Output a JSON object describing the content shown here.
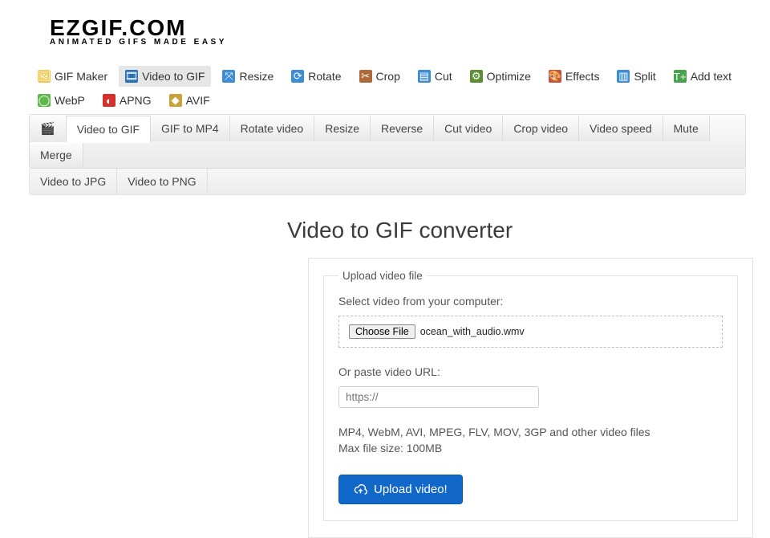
{
  "logo": {
    "main": "EZGIF.COM",
    "sub": "ANIMATED GIFS MADE EASY"
  },
  "main_nav": [
    {
      "label": "GIF Maker",
      "icon": "image-icon",
      "icon_glyph": "🖼",
      "icon_bg": "#f2c94c"
    },
    {
      "label": "Video to GIF",
      "icon": "film-icon",
      "icon_glyph": "🎞",
      "icon_bg": "#2d6fb3",
      "active": true
    },
    {
      "label": "Resize",
      "icon": "resize-icon",
      "icon_glyph": "⤧",
      "icon_bg": "#3c8dd6"
    },
    {
      "label": "Rotate",
      "icon": "rotate-icon",
      "icon_glyph": "⟳",
      "icon_bg": "#3c8dd6"
    },
    {
      "label": "Crop",
      "icon": "crop-icon",
      "icon_glyph": "✂",
      "icon_bg": "#b06a3a"
    },
    {
      "label": "Cut",
      "icon": "cut-icon",
      "icon_glyph": "▤",
      "icon_bg": "#3c8dd6"
    },
    {
      "label": "Optimize",
      "icon": "optimize-icon",
      "icon_glyph": "⚙",
      "icon_bg": "#5c8f33"
    },
    {
      "label": "Effects",
      "icon": "effects-icon",
      "icon_glyph": "🎨",
      "icon_bg": "#c7553c"
    },
    {
      "label": "Split",
      "icon": "split-icon",
      "icon_glyph": "▥",
      "icon_bg": "#3c8dd6"
    },
    {
      "label": "Add text",
      "icon": "addtext-icon",
      "icon_glyph": "T+",
      "icon_bg": "#4aa24a"
    },
    {
      "label": "WebP",
      "icon": "webp-icon",
      "icon_glyph": "◯",
      "icon_bg": "#5fb94a"
    },
    {
      "label": "APNG",
      "icon": "apng-icon",
      "icon_glyph": "◐",
      "icon_bg": "#d6302a"
    },
    {
      "label": "AVIF",
      "icon": "avif-icon",
      "icon_glyph": "◆",
      "icon_bg": "#c9a23a"
    }
  ],
  "sub_nav1": [
    {
      "label": "Video to GIF",
      "active": true
    },
    {
      "label": "GIF to MP4"
    },
    {
      "label": "Rotate video"
    },
    {
      "label": "Resize"
    },
    {
      "label": "Reverse"
    },
    {
      "label": "Cut video"
    },
    {
      "label": "Crop video"
    },
    {
      "label": "Video speed"
    },
    {
      "label": "Mute"
    },
    {
      "label": "Merge"
    }
  ],
  "sub_nav2": [
    {
      "label": "Video to JPG"
    },
    {
      "label": "Video to PNG"
    }
  ],
  "page": {
    "title": "Video to GIF converter",
    "legend": "Upload video file",
    "select_label": "Select video from your computer:",
    "choose_button": "Choose File",
    "chosen_filename": "ocean_with_audio.wmv",
    "or_url_label": "Or paste video URL:",
    "url_placeholder": "https://",
    "hint_line1": "MP4, WebM, AVI, MPEG, FLV, MOV, 3GP and other video files",
    "hint_line2": "Max file size: 100MB",
    "upload_button": "Upload video!"
  }
}
